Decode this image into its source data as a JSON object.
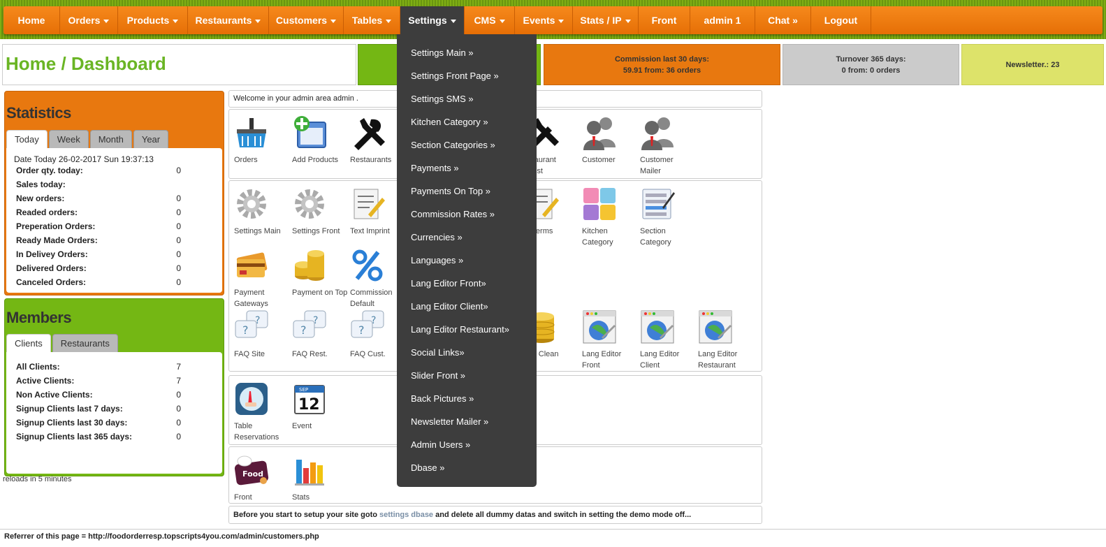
{
  "nav": {
    "items": [
      {
        "label": "Home",
        "caret": false
      },
      {
        "label": "Orders",
        "caret": true
      },
      {
        "label": "Products",
        "caret": true
      },
      {
        "label": "Restaurants",
        "caret": true
      },
      {
        "label": "Customers",
        "caret": true
      },
      {
        "label": "Tables",
        "caret": true
      },
      {
        "label": "Settings",
        "caret": true,
        "active": true
      },
      {
        "label": "CMS",
        "caret": true
      },
      {
        "label": "Events",
        "caret": true
      },
      {
        "label": "Stats / IP",
        "caret": true
      },
      {
        "label": "Front",
        "caret": false
      },
      {
        "label": "admin 1",
        "caret": false
      },
      {
        "label": "Chat »",
        "caret": false
      },
      {
        "label": "Logout",
        "caret": false
      }
    ]
  },
  "header": {
    "title": "Home / Dashboard",
    "commission": {
      "line1": "Commission last 30 days:",
      "line2": "59.91 from: 36 orders"
    },
    "turnover": {
      "line1": "Turnover 365 days:",
      "line2": "0 from: 0 orders"
    },
    "newsletter": "Newsletter.: 23"
  },
  "statistics": {
    "title": "Statistics",
    "tabs": [
      "Today",
      "Week",
      "Month",
      "Year"
    ],
    "date": "Date Today 26-02-2017 Sun 19:37:13",
    "rows": [
      {
        "label": "Order qty. today:",
        "value": "0"
      },
      {
        "label": "Sales today:",
        "value": ""
      },
      {
        "label": "New orders:",
        "value": "0"
      },
      {
        "label": "Readed orders:",
        "value": "0"
      },
      {
        "label": "Preperation Orders:",
        "value": "0"
      },
      {
        "label": "Ready Made Orders:",
        "value": "0"
      },
      {
        "label": "In Delivey Orders:",
        "value": "0"
      },
      {
        "label": "Delivered Orders:",
        "value": "0"
      },
      {
        "label": "Canceled Orders:",
        "value": "0"
      }
    ]
  },
  "members": {
    "title": "Members",
    "tabs": [
      "Clients",
      "Restaurants"
    ],
    "rows": [
      {
        "label": "All Clients:",
        "value": "7"
      },
      {
        "label": "Active Clients:",
        "value": "7"
      },
      {
        "label": "Non Active Clients:",
        "value": "0"
      },
      {
        "label": "Signup Clients last 7 days:",
        "value": "0"
      },
      {
        "label": "Signup Clients last 30 days:",
        "value": "0"
      },
      {
        "label": "Signup Clients last 365 days:",
        "value": "0"
      }
    ],
    "reload_note": "reloads in 5 minutes"
  },
  "welcome": "Welcome in your admin area admin .",
  "tiles": {
    "orders": "Orders",
    "add_products": "Add Products",
    "restaurants": "Restaurants",
    "restaurant_suggest": "estaurant\nggest",
    "customer": "Customer",
    "customer_mailer": "Customer Mailer",
    "settings_main": "Settings Main",
    "settings_front": "Settings Front",
    "text_imprint": "Text Imprint",
    "text_terms": "xt Terms",
    "kitchen_category": "Kitchen\nCategory",
    "section_category": "Section\nCategory",
    "payment_gateways": "Payment\nGateways",
    "payment_on_top": "Payment on Top",
    "commission_default": "Commission\nDefault",
    "faq_site": "FAQ Site",
    "faq_rest": "FAQ Rest.",
    "faq_cust": "FAQ Cust.",
    "dbase_clean": "ase Clean",
    "lang_editor_front": "Lang Editor\nFront",
    "lang_editor_client": "Lang Editor\nClient",
    "lang_editor_restaurant": "Lang Editor\nRestaurant",
    "table_reservations": "Table\nReservations",
    "event": "Event",
    "front": "Front",
    "stats": "Stats"
  },
  "bottom_note": {
    "before": "Before you start to setup your site goto ",
    "link": "settings dbase",
    "after": " and delete all dummy datas and switch in setting the demo mode off..."
  },
  "referrer": "Referrer of this page = http://foodorderresp.topscripts4you.com/admin/customers.php",
  "settings_menu": [
    "Settings Main »",
    "Settings Front Page »",
    "Settings SMS »",
    "Kitchen Category »",
    "Section Categories »",
    "Payments »",
    "Payments On Top »",
    "Commission Rates »",
    "Currencies »",
    "Languages »",
    "Lang Editor Front»",
    "Lang Editor Client»",
    "Lang Editor Restaurant»",
    "Social Links»",
    "Slider Front »",
    "Back Pictures »",
    "Newsletter Mailer »",
    "Admin Users »",
    "Dbase »"
  ],
  "colors": {
    "nav_orange": "#e8780f",
    "green": "#74b714",
    "title_green": "#6ab524",
    "dropdown_bg": "#3d3d3d"
  }
}
